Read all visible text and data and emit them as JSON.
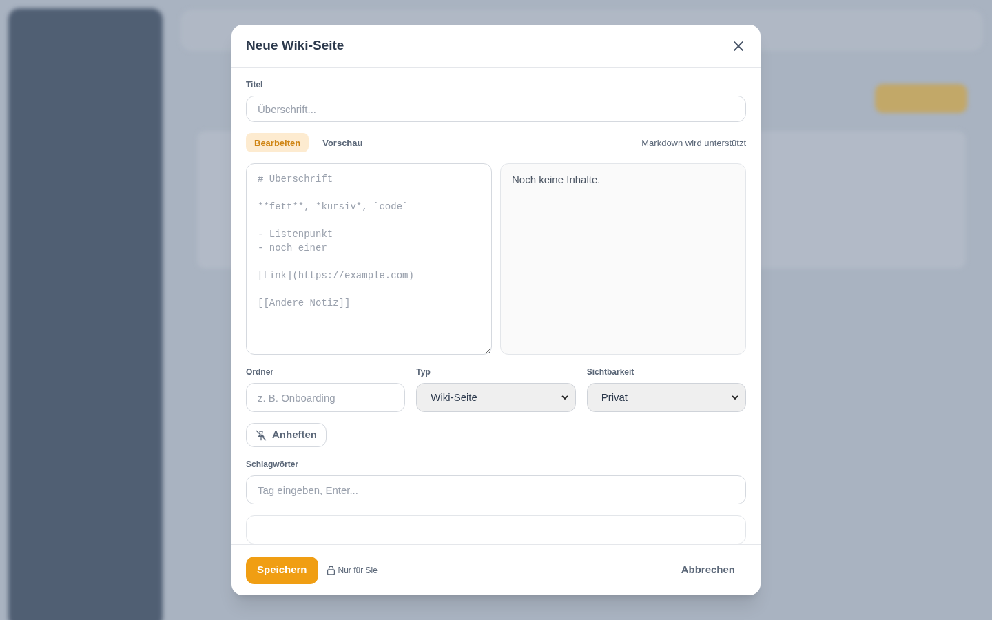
{
  "dialog": {
    "title": "Neue Wiki-Seite"
  },
  "title_field": {
    "label": "Titel",
    "placeholder": "Überschrift..."
  },
  "tabs": [
    {
      "label": "Bearbeiten",
      "selected": true
    },
    {
      "label": "Vorschau",
      "selected": false
    }
  ],
  "markdown_hint": "Markdown wird unterstützt",
  "editor": {
    "placeholder": "# Überschrift\n\n**fett**, *kursiv*, `code`\n\n- Listenpunkt\n- noch einer\n\n[Link](https://example.com)\n\n[[Andere Notiz]]"
  },
  "preview": {
    "text": "Noch keine Inhalte."
  },
  "folder": {
    "label": "Ordner",
    "placeholder": "z. B. Onboarding"
  },
  "type": {
    "label": "Typ",
    "value": "Wiki-Seite"
  },
  "visibility": {
    "label": "Sichtbarkeit",
    "value": "Privat"
  },
  "pin_button": {
    "label": "Anheften",
    "pinned": false
  },
  "tags": {
    "label": "Schlagwörter",
    "placeholder": "Tag eingeben, Enter..."
  },
  "footer": {
    "save": "Speichern",
    "visibility_note": "Nur für Sie",
    "cancel": "Abbrechen"
  }
}
